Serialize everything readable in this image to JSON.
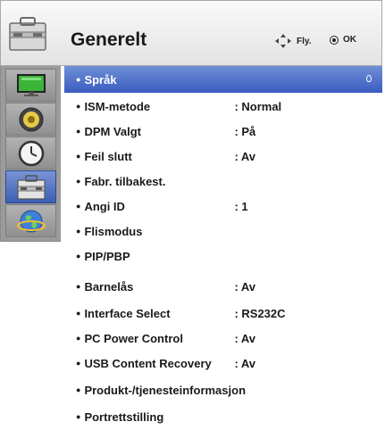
{
  "header": {
    "title": "Generelt",
    "nav_hint": "Fly.",
    "ok_hint": "OK",
    "icon": "toolbox-icon"
  },
  "sidebar": {
    "items": [
      {
        "icon": "monitor-icon",
        "active": false
      },
      {
        "icon": "speaker-icon",
        "active": false
      },
      {
        "icon": "clock-icon",
        "active": false
      },
      {
        "icon": "toolbox-icon",
        "active": true
      },
      {
        "icon": "globe-icon",
        "active": false
      }
    ]
  },
  "menu": {
    "items": [
      {
        "label": "Språk",
        "value": ""
      },
      {
        "label": "ISM-metode",
        "value": ": Normal"
      },
      {
        "label": "DPM Valgt",
        "value": ": På"
      },
      {
        "label": "Feil slutt",
        "value": ": Av"
      },
      {
        "label": "Fabr. tilbakest.",
        "value": ""
      },
      {
        "label": "Angi ID",
        "value": ": 1"
      },
      {
        "label": "Flismodus",
        "value": ""
      },
      {
        "label": "PIP/PBP",
        "value": ""
      },
      {
        "label": "Barnelås",
        "value": ": Av"
      },
      {
        "label": "Interface Select",
        "value": ": RS232C"
      },
      {
        "label": "PC Power Control",
        "value": ": Av"
      },
      {
        "label": "USB Content Recovery",
        "value": ": Av"
      },
      {
        "label": "Produkt-/tjenesteinformasjon",
        "value": ""
      },
      {
        "label": "Portrettstilling",
        "value": ""
      }
    ],
    "bullet": "●"
  },
  "colors": {
    "accent": "#3a5cc0",
    "sidebar_bg": "#9b9b9b"
  }
}
